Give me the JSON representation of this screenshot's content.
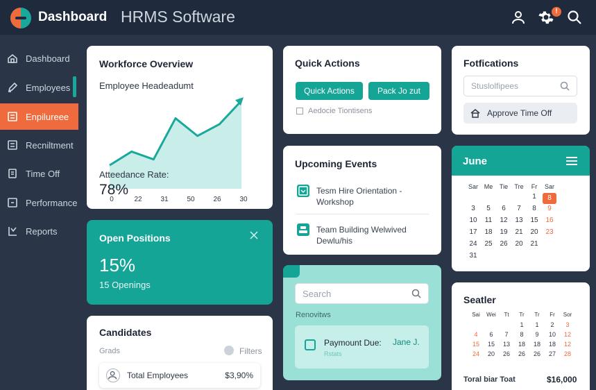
{
  "header": {
    "brand": "Dashboard",
    "app_title": "HRMS Software",
    "notification_count": "!",
    "icons": [
      "user-icon",
      "gear-icon",
      "search-icon"
    ]
  },
  "sidebar": {
    "items": [
      {
        "label": "Dashboard",
        "icon": "home-icon"
      },
      {
        "label": "Employees",
        "icon": "pencil-icon"
      },
      {
        "label": "Enpilureee",
        "icon": "list-icon",
        "active": true
      },
      {
        "label": "Recniltment",
        "icon": "list-icon"
      },
      {
        "label": "Time Off",
        "icon": "clipboard-icon"
      },
      {
        "label": "Performance",
        "icon": "square-icon"
      },
      {
        "label": "Reports",
        "icon": "chart-icon"
      }
    ]
  },
  "workforce": {
    "title": "Workforce Overview",
    "chart_title": "Employee Headeadumt",
    "attendance_label": "Atteedance Rate:",
    "attendance_value": "78%"
  },
  "chart_data": {
    "type": "area",
    "title": "Employee Headeadumt",
    "categories": [
      "0",
      "22",
      "31",
      "50",
      "26",
      "30"
    ],
    "values": [
      24,
      38,
      30,
      72,
      54,
      66,
      90
    ],
    "ylim": [
      0,
      100
    ],
    "color": "#19a89c",
    "fill": "#c9ede8"
  },
  "open_positions": {
    "title": "Open Positions",
    "percent": "15%",
    "openings": "15 Openings"
  },
  "candidates": {
    "title": "Candidates",
    "grads_label": "Grads",
    "filters_label": "Filters",
    "row_label": "Total Employees",
    "row_value": "$3,90%"
  },
  "quick_actions": {
    "title": "Quick Actions",
    "btn1": "Quick Actions",
    "btn2": "Pack Jo zut",
    "note": "Aedocie Tiontisens"
  },
  "upcoming": {
    "title": "Upcoming Events",
    "events": [
      {
        "line1": "Tesm Hire Orientation -",
        "line2": "Workshop"
      },
      {
        "line1": "Team Building Welwived",
        "line2": "Dewlu/his"
      }
    ]
  },
  "search_card": {
    "placeholder": "Search",
    "section_label": "Renovitws",
    "item_title": "Paymount Due:",
    "item_sub": "Rstats",
    "item_value": "Jane J."
  },
  "notifications": {
    "title": "Fotfications",
    "input_placeholder": "Stuslolfipees",
    "approve_label": "Approve Time Off"
  },
  "calendar": {
    "month": "June",
    "weekdays": [
      "Sar",
      "Me",
      "Tie",
      "Tre",
      "Fr",
      "Sar"
    ],
    "rows": [
      [
        "",
        "",
        "",
        "",
        "1",
        "8"
      ],
      [
        "3",
        "5",
        "6",
        "7",
        "8",
        "9"
      ],
      [
        "10",
        "11",
        "12",
        "13",
        "15",
        "16"
      ],
      [
        "17",
        "18",
        "19",
        "21",
        "20",
        "23"
      ],
      [
        "24",
        "25",
        "26",
        "20",
        "21",
        ""
      ],
      [
        "31",
        "",
        "",
        "",
        "",
        ""
      ]
    ],
    "selected": "8"
  },
  "small_calendar": {
    "title": "Seatler",
    "weekdays": [
      "Sai",
      "Wei",
      "Tt",
      "Tr",
      "Tr",
      "Fr",
      "Sor"
    ],
    "rows": [
      [
        "",
        "",
        "",
        "",
        "",
        "",
        ""
      ],
      [
        "",
        "",
        "",
        "1",
        "1",
        "2",
        "3"
      ],
      [
        "4",
        "6",
        "7",
        "8",
        "9",
        "10",
        "12"
      ],
      [
        "15",
        "15",
        "13",
        "18",
        "18",
        "18",
        "12"
      ],
      [
        "24",
        "20",
        "26",
        "26",
        "26",
        "27",
        "28"
      ]
    ],
    "total_label": "Toral biar Toat",
    "total_value": "$16,000"
  },
  "colors": {
    "teal": "#19a89c",
    "orange": "#ef6a3c",
    "navy": "#1f2b3c"
  }
}
